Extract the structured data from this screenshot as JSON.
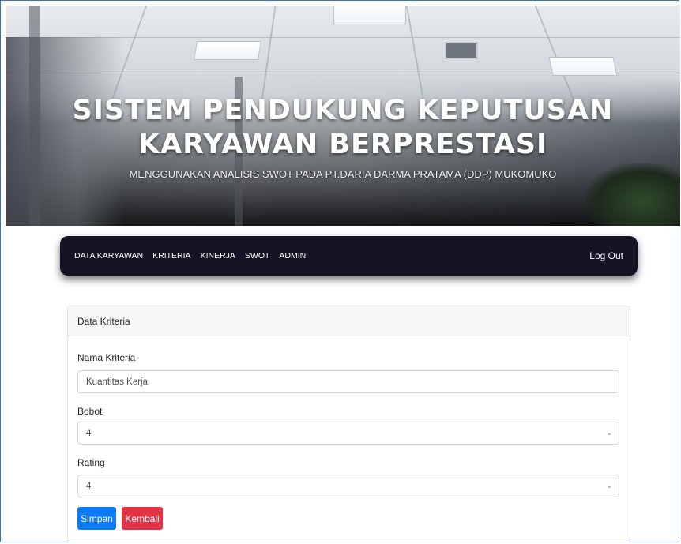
{
  "hero": {
    "title_line1": "SISTEM PENDUKUNG KEPUTUSAN",
    "title_line2": "KARYAWAN BERPRESTASI",
    "subtitle": "MENGGUNAKAN ANALISIS SWOT PADA PT.DARIA DARMA PRATAMA (DDP) MUKOMUKO"
  },
  "nav": {
    "links": [
      "DATA KARYAWAN",
      "KRITERIA",
      "KINERJA",
      "SWOT",
      "ADMIN"
    ],
    "logout": "Log Out"
  },
  "card": {
    "title": "Data Kriteria",
    "fields": {
      "nama": {
        "label": "Nama Kriteria",
        "value": "Kuantitas Kerja"
      },
      "bobot": {
        "label": "Bobot",
        "value": "4"
      },
      "rating": {
        "label": "Rating",
        "value": "4"
      }
    },
    "buttons": {
      "save": "Simpan",
      "back": "Kembali"
    }
  },
  "colors": {
    "nav_bg": "#161325",
    "primary": "#0d7bf6",
    "danger": "#e03345"
  }
}
